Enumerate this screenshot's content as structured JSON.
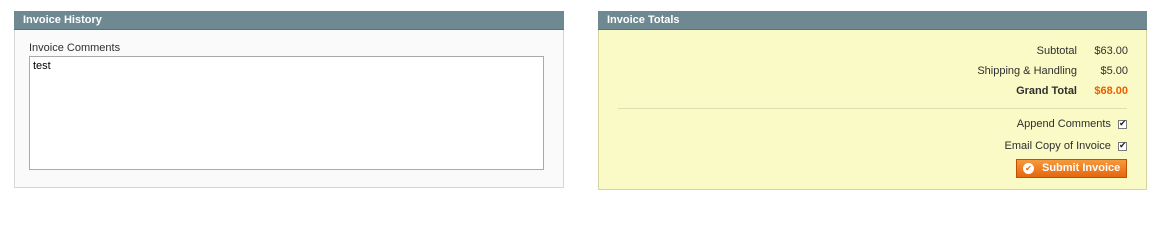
{
  "invoice_history": {
    "title": "Invoice History",
    "comments_label": "Invoice Comments",
    "comments_value": "test"
  },
  "invoice_totals": {
    "title": "Invoice Totals",
    "subtotal_label": "Subtotal",
    "subtotal_value": "$63.00",
    "shipping_label": "Shipping & Handling",
    "shipping_value": "$5.00",
    "grand_total_label": "Grand Total",
    "grand_total_value": "$68.00",
    "append_comments_label": "Append Comments",
    "append_comments_checked": true,
    "email_copy_label": "Email Copy of Invoice",
    "email_copy_checked": true,
    "submit_label": "Submit Invoice",
    "submit_icon": "check-circle-icon"
  },
  "colors": {
    "header_bg": "#6f8992",
    "totals_bg": "#fafac6",
    "grand_total": "#eb5e00",
    "button_bg": "#e5660e"
  }
}
